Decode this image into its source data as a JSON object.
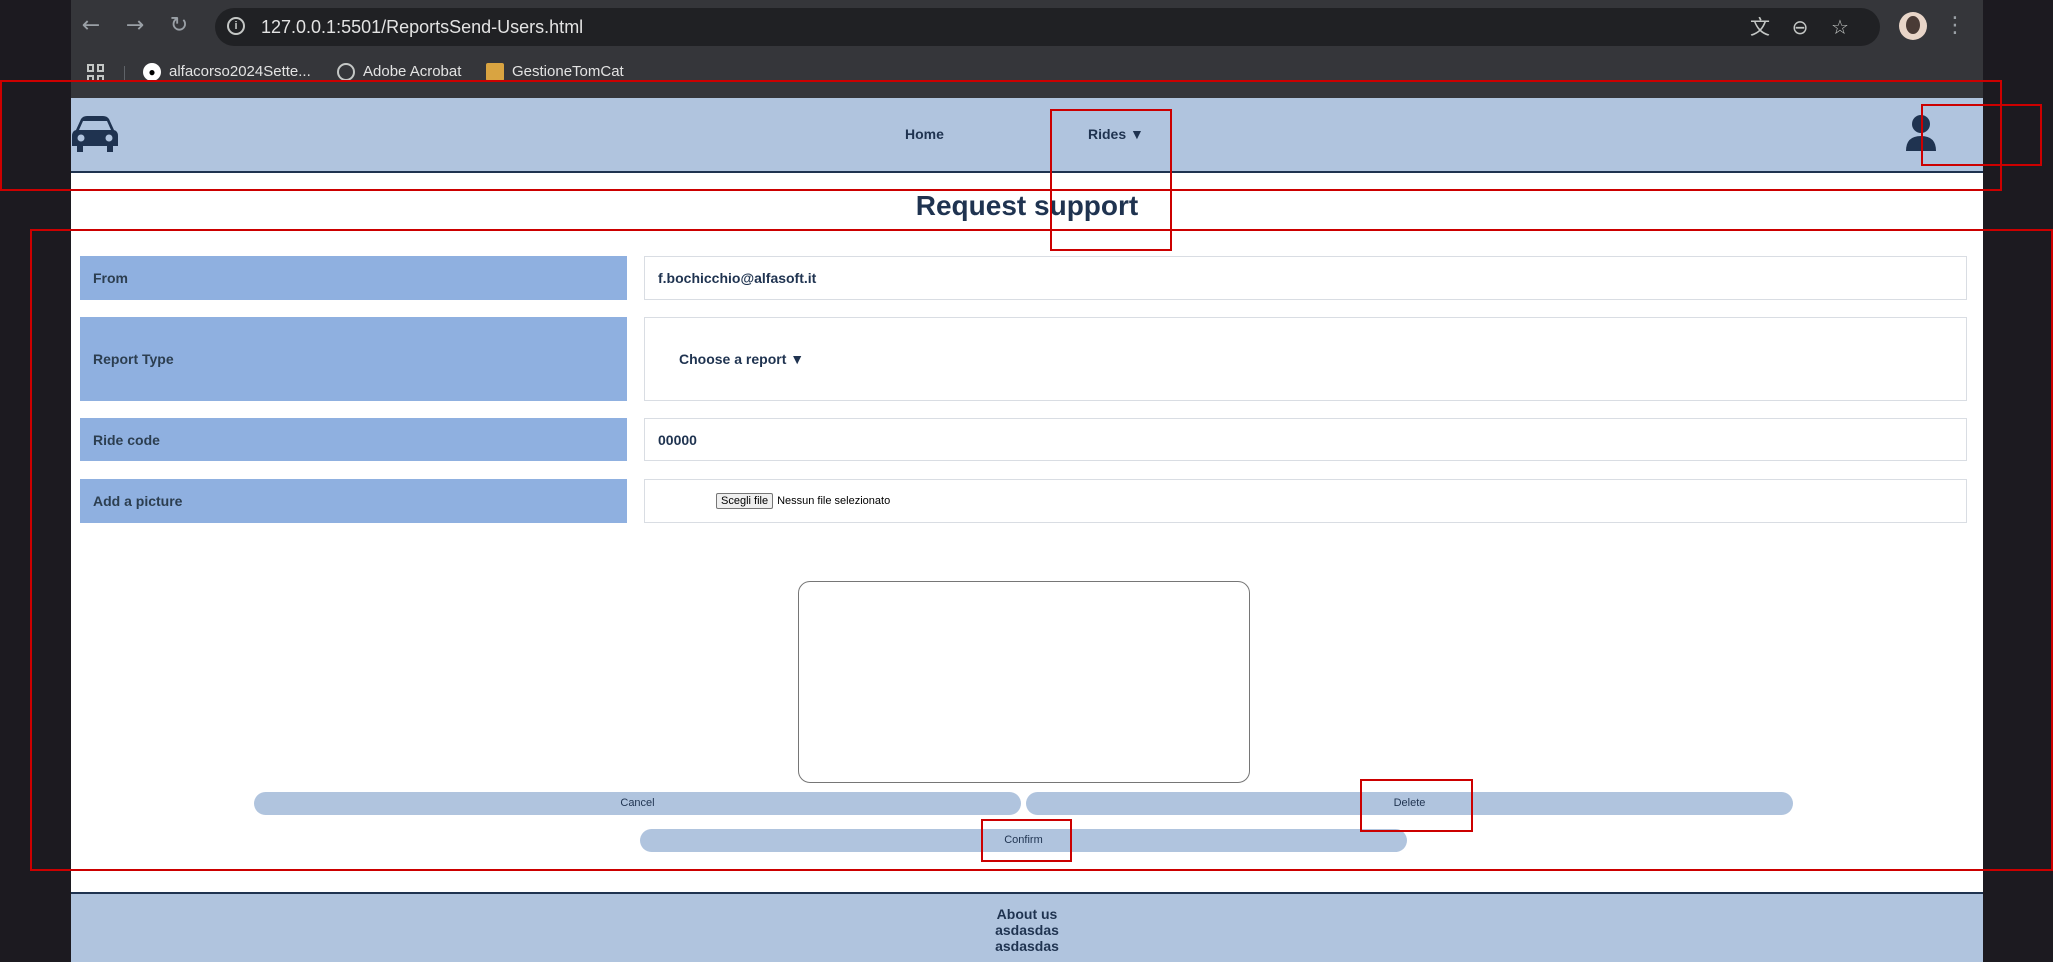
{
  "browser": {
    "url": "127.0.0.1:5501/ReportsSend-Users.html",
    "bookmarks": [
      {
        "label": "alfacorso2024Sette...",
        "icon": "github-icon"
      },
      {
        "label": "Adobe Acrobat",
        "icon": "globe-icon"
      },
      {
        "label": "GestioneTomCat",
        "icon": "tomcat-icon"
      }
    ]
  },
  "header": {
    "nav": {
      "home": "Home",
      "rides": "Rides ▼"
    }
  },
  "page": {
    "title": "Request support"
  },
  "form": {
    "from": {
      "label": "From",
      "value": "f.bochicchio@alfasoft.it"
    },
    "report_type": {
      "label": "Report Type",
      "value": "Choose a report ▼"
    },
    "ride_code": {
      "label": "Ride code",
      "value": "00000"
    },
    "picture": {
      "label": "Add a picture",
      "button": "Scegli file",
      "status": "Nessun file selezionato"
    }
  },
  "buttons": {
    "cancel": "Cancel",
    "delete": "Delete",
    "confirm": "Confirm"
  },
  "footer": {
    "line1": "About us",
    "line2": "asdasdas",
    "line3": "asdasdas"
  },
  "colors": {
    "header_bg": "#b0c4de",
    "label_bg": "#8fb0e0",
    "text_dark": "#1f3350",
    "annotation": "#cc0000"
  }
}
